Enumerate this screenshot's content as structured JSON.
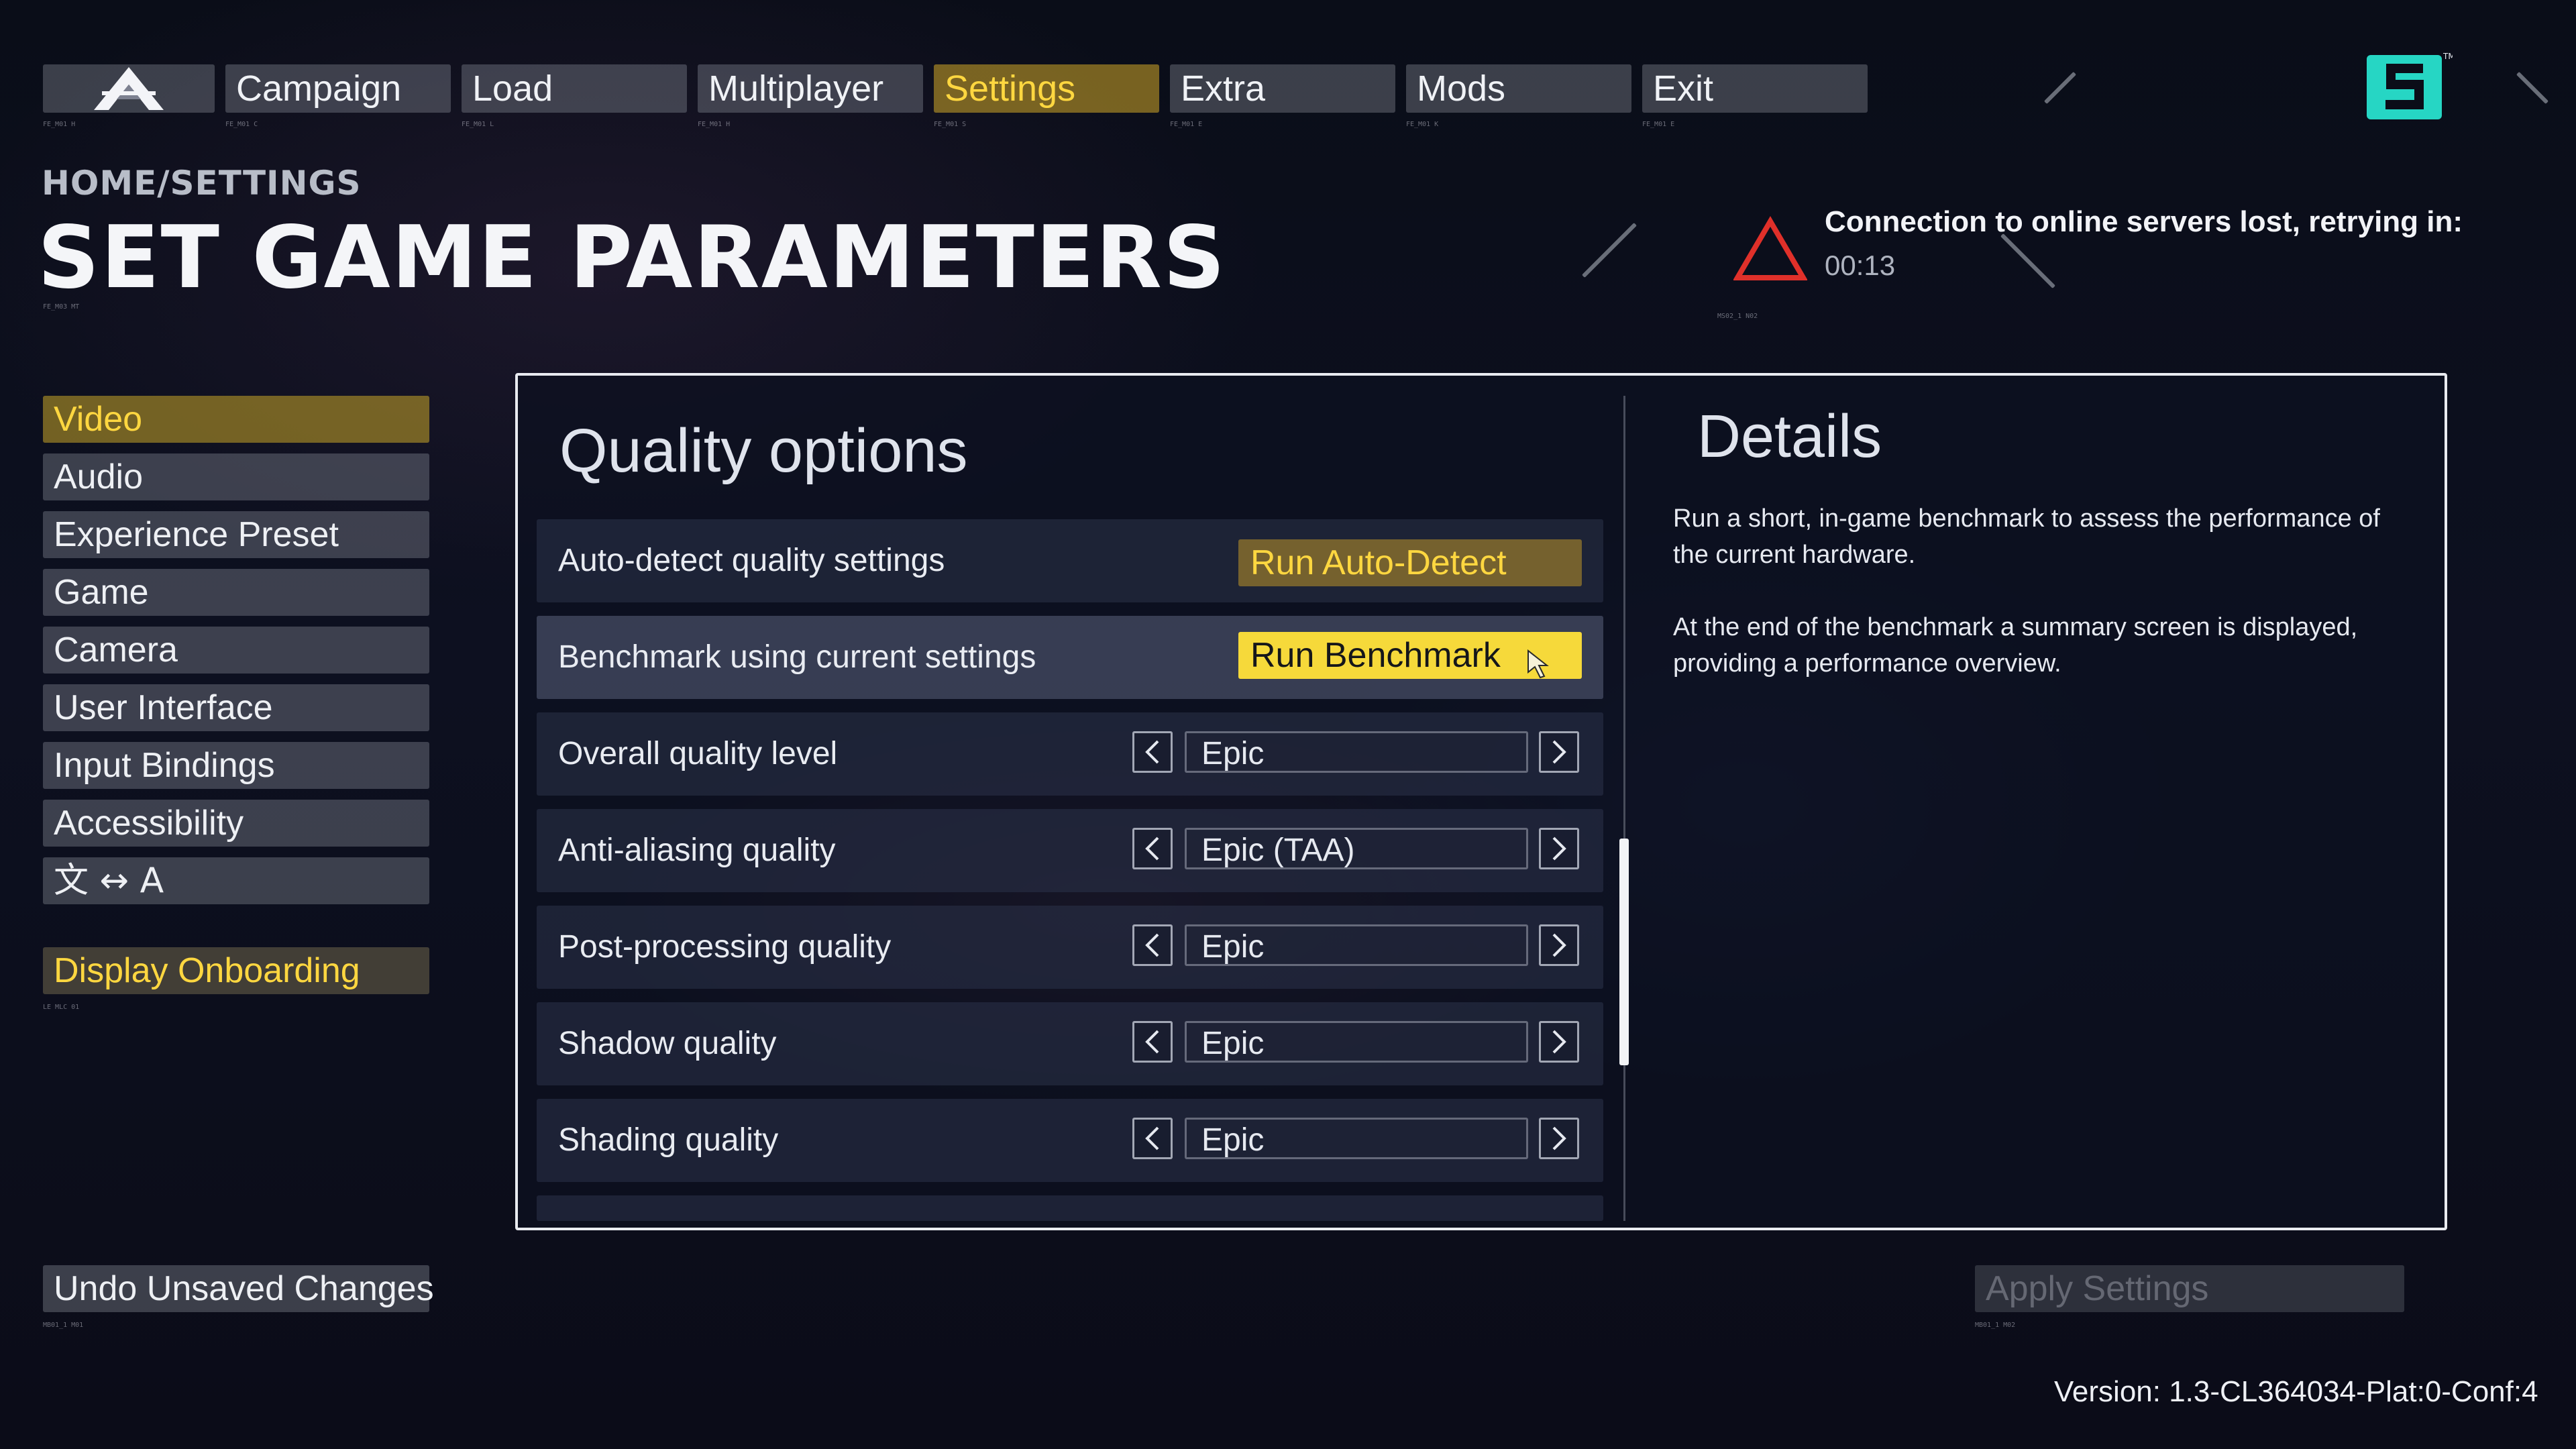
{
  "nav": {
    "items": [
      {
        "label": "Campaign"
      },
      {
        "label": "Load"
      },
      {
        "label": "Multiplayer"
      },
      {
        "label": "Settings"
      },
      {
        "label": "Extra"
      },
      {
        "label": "Mods"
      },
      {
        "label": "Exit"
      }
    ],
    "active": "Settings",
    "tiny_codes": [
      "FE_M01 H",
      "FE_M01 C",
      "FE_M01 L",
      "FE_M01 H",
      "FE_M01 S",
      "FE_M01 E",
      "FE_M01 K",
      "FE_M01 E"
    ]
  },
  "header": {
    "breadcrumb": "HOME/SETTINGS",
    "title": "SET GAME PARAMETERS",
    "title_code": "FE_M03 MT"
  },
  "connection_warning": {
    "message": "Connection to online servers lost, retrying in:",
    "timer": "00:13",
    "code": "MS02_1 N02",
    "icon": "warning-triangle-icon",
    "icon_color": "#e0302a"
  },
  "sidebar": {
    "items": [
      {
        "label": "Video",
        "active": true
      },
      {
        "label": "Audio"
      },
      {
        "label": "Experience Preset"
      },
      {
        "label": "Game"
      },
      {
        "label": "Camera"
      },
      {
        "label": "User Interface"
      },
      {
        "label": "Input Bindings"
      },
      {
        "label": "Accessibility"
      },
      {
        "label": "文 ↔ A"
      }
    ],
    "onboarding": "Display Onboarding",
    "onboarding_code": "LE MLC 01"
  },
  "quality": {
    "title": "Quality options",
    "auto_detect": {
      "label": "Auto-detect quality settings",
      "button": "Run Auto-Detect"
    },
    "benchmark": {
      "label": "Benchmark using current settings",
      "button": "Run Benchmark"
    },
    "settings": [
      {
        "label": "Overall quality level",
        "value": "Epic"
      },
      {
        "label": "Anti-aliasing quality",
        "value": "Epic (TAA)"
      },
      {
        "label": "Post-processing quality",
        "value": "Epic"
      },
      {
        "label": "Shadow quality",
        "value": "Epic"
      },
      {
        "label": "Shading quality",
        "value": "Epic"
      }
    ]
  },
  "details": {
    "title": "Details",
    "paragraphs": [
      "Run a short, in-game benchmark to assess the performance of the current hardware.",
      "At the end of the benchmark a summary screen is displayed, providing a performance overview."
    ]
  },
  "footer": {
    "undo": "Undo Unsaved Changes",
    "apply": "Apply Settings",
    "version": "Version: 1.3-CL364034-Plat:0-Conf:4",
    "undo_code": "MB01_1 M01",
    "apply_code": "MB01_1 M02"
  },
  "colors": {
    "accent": "#ffd740",
    "bright_button": "#f6d93a",
    "brand_logo": "#26d6c4"
  }
}
